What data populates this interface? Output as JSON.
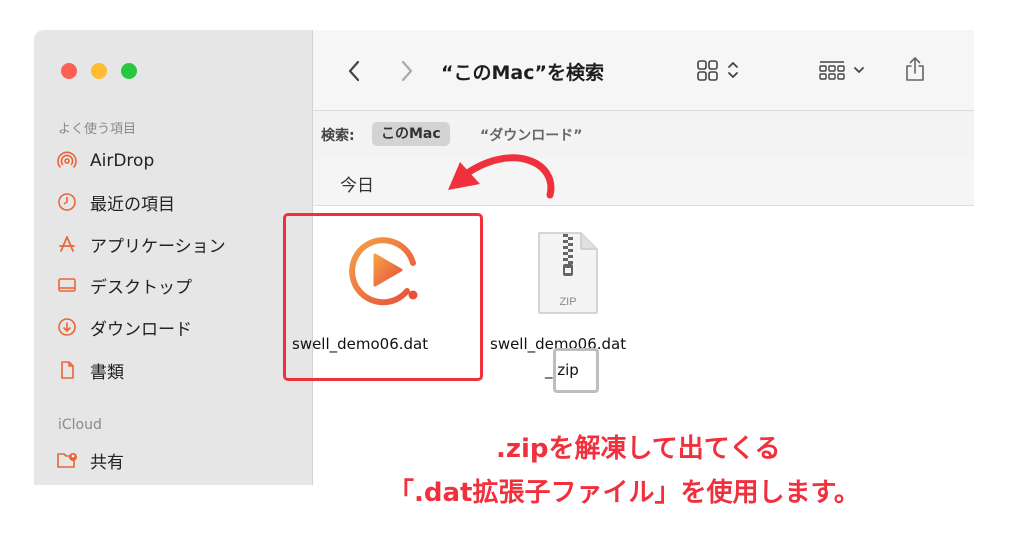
{
  "sidebar": {
    "favorites_title": "よく使う項目",
    "items": [
      {
        "label": "AirDrop",
        "icon": "airdrop-icon"
      },
      {
        "label": "最近の項目",
        "icon": "clock-icon"
      },
      {
        "label": "アプリケーション",
        "icon": "applications-icon"
      },
      {
        "label": "デスクトップ",
        "icon": "desktop-icon"
      },
      {
        "label": "ダウンロード",
        "icon": "download-icon"
      },
      {
        "label": "書類",
        "icon": "document-icon"
      }
    ],
    "icloud_title": "iCloud",
    "icloud_items": [
      {
        "label": "共有",
        "icon": "shared-folder-icon"
      }
    ]
  },
  "toolbar": {
    "title": "“このMac”を検索"
  },
  "scope": {
    "label": "検索:",
    "selected": "このMac",
    "option": "“ダウンロード”"
  },
  "group": {
    "label": "今日"
  },
  "files": [
    {
      "name": "swell_demo06.dat",
      "icon": "video-file-icon"
    },
    {
      "name_line1": "swell_demo06.dat",
      "name_line2": "_.zip",
      "icon": "zip-file-icon",
      "badge": "ZIP"
    }
  ],
  "annotation": {
    "zip_mark": ".zip",
    "caption_line1": ".zipを解凍して出てくる",
    "caption_line2": "「.dat拡張子ファイル」を使用します。"
  },
  "colors": {
    "accent": "#f0313d",
    "video_icon": "#e8663a"
  }
}
